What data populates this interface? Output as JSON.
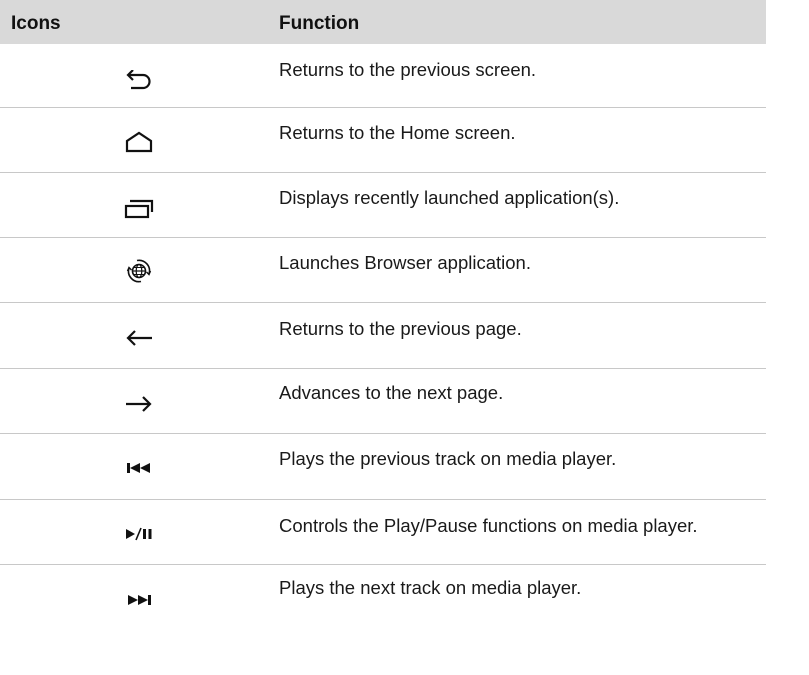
{
  "table": {
    "headers": {
      "icons": "Icons",
      "function": "Function"
    },
    "rows": [
      {
        "icon": "back-icon",
        "text": "Returns to the previous screen."
      },
      {
        "icon": "home-icon",
        "text": "Returns to the Home screen."
      },
      {
        "icon": "recent-apps-icon",
        "text": "Displays recently launched application(s)."
      },
      {
        "icon": "browser-icon",
        "text": "Launches Browser application."
      },
      {
        "icon": "arrow-left-icon",
        "text": "Returns to the previous page."
      },
      {
        "icon": "arrow-right-icon",
        "text": "Advances to the next page."
      },
      {
        "icon": "previous-track-icon",
        "text": "Plays the previous track on media player."
      },
      {
        "icon": "play-pause-icon",
        "text": "Controls the Play/Pause functions on media player."
      },
      {
        "icon": "next-track-icon",
        "text": "Plays the next track on media player."
      }
    ]
  }
}
